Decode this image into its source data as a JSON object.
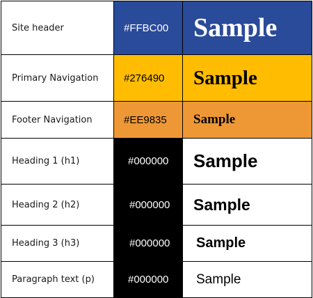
{
  "rows": [
    {
      "label": "Site header",
      "code": "#FFBC00",
      "sample": "Sample",
      "bg": "#2a4a9a",
      "code_color": "#ffffff",
      "sample_bg": "#2a4a9a",
      "sample_color": "#ffffff"
    },
    {
      "label": "Primary Navigation",
      "code": "#276490",
      "sample": "Sample",
      "bg": "#ffbc00",
      "code_color": "#000000",
      "sample_bg": "#ffbc00",
      "sample_color": "#000000"
    },
    {
      "label": "Footer Navigation",
      "code": "#EE9835",
      "sample": "Sample",
      "bg": "#ee9835",
      "code_color": "#000000",
      "sample_bg": "#ee9835",
      "sample_color": "#000000"
    },
    {
      "label": "Heading 1 (h1)",
      "code": "#000000",
      "sample": "Sample",
      "bg": "#000000",
      "code_color": "#ffffff",
      "sample_bg": "#ffffff",
      "sample_color": "#000000"
    },
    {
      "label": "Heading 2 (h2)",
      "code": "#000000",
      "sample": "Sample",
      "bg": "#000000",
      "code_color": "#ffffff",
      "sample_bg": "#ffffff",
      "sample_color": "#000000"
    },
    {
      "label": "Heading 3 (h3)",
      "code": "#000000",
      "sample": "Sample",
      "bg": "#000000",
      "code_color": "#ffffff",
      "sample_bg": "#ffffff",
      "sample_color": "#000000"
    },
    {
      "label": "Paragraph text (p)",
      "code": "#000000",
      "sample": "Sample",
      "bg": "#000000",
      "code_color": "#ffffff",
      "sample_bg": "#ffffff",
      "sample_color": "#000000"
    }
  ]
}
